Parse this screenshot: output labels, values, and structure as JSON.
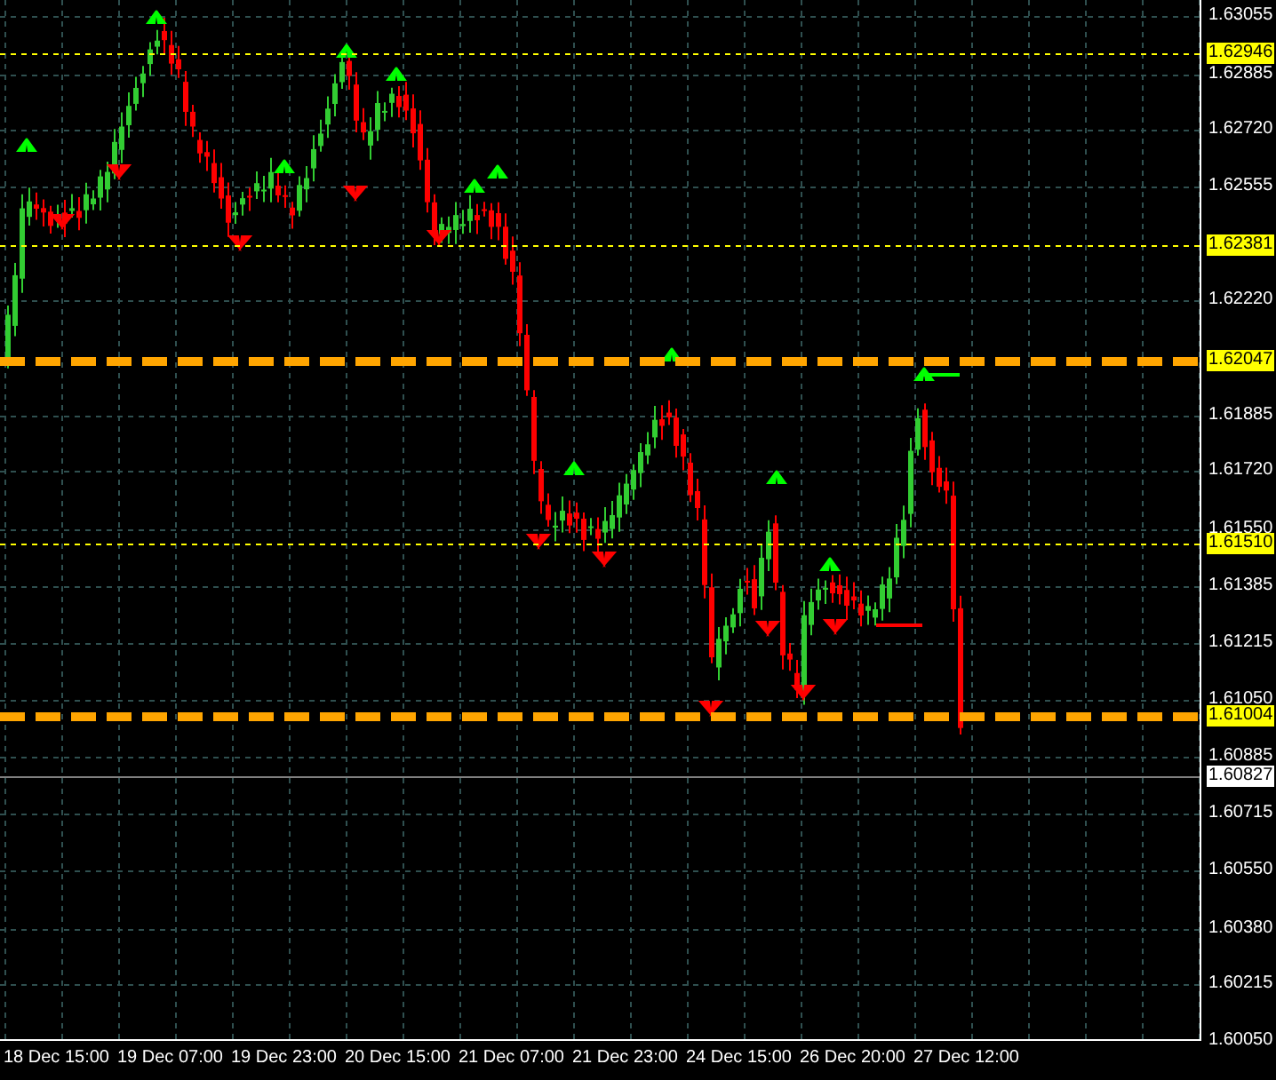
{
  "price_axis": [
    "1.63055",
    "1.62885",
    "1.62720",
    "1.62555",
    "1.62220",
    "1.61885",
    "1.61720",
    "1.61550",
    "1.61385",
    "1.61215",
    "1.61050",
    "1.60885",
    "1.60715",
    "1.60550",
    "1.60380",
    "1.60215",
    "1.60050"
  ],
  "levels": [
    {
      "price": "1.62946",
      "kind": "alert"
    },
    {
      "price": "1.62381",
      "kind": "alert"
    },
    {
      "price": "1.62047",
      "kind": "zone"
    },
    {
      "price": "1.61510",
      "kind": "alert"
    },
    {
      "price": "1.61004",
      "kind": "zone"
    },
    {
      "price": "1.60827",
      "kind": "current"
    }
  ],
  "time_axis": [
    "18 Dec 15:00",
    "19 Dec 07:00",
    "19 Dec 23:00",
    "20 Dec 15:00",
    "21 Dec 07:00",
    "21 Dec 23:00",
    "24 Dec 15:00",
    "26 Dec 20:00",
    "27 Dec 12:00"
  ]
}
